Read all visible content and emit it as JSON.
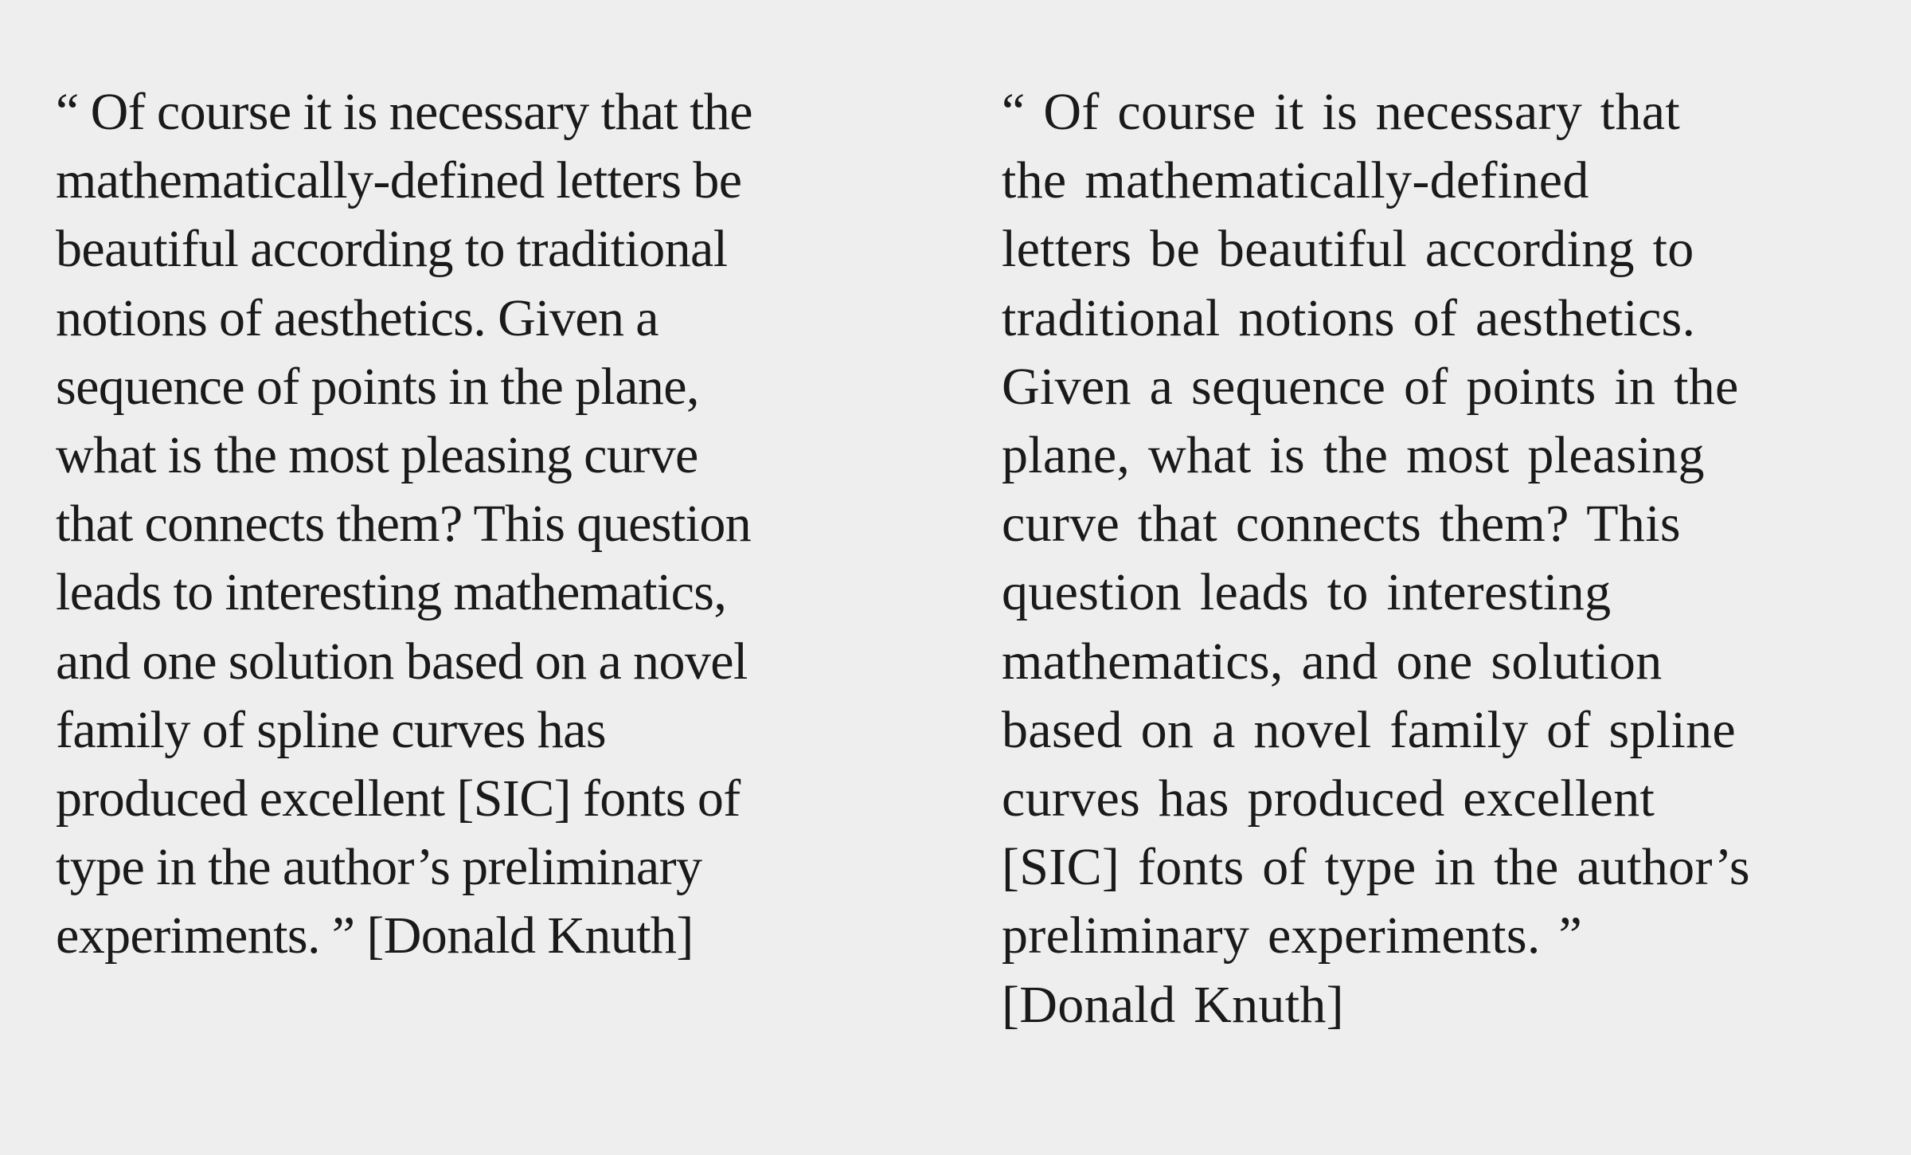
{
  "left_column": {
    "lines": [
      "“ Of course it is necessary that the",
      "mathematically-defined letters be",
      "beautiful according to traditional",
      "notions of aesthetics. Given a",
      "sequence of points in the plane,",
      "what is the most pleasing curve",
      "that connects them? This question",
      "leads to interesting mathematics,",
      "and one solution based on a novel",
      "family of spline curves has",
      "produced excellent [SIC] fonts of",
      "type in the author’s preliminary",
      "experiments. ” [Donald Knuth]"
    ]
  },
  "right_column": {
    "lines": [
      "“ Of course it is necessary that",
      "the mathematically-defined",
      "letters be beautiful according to",
      "traditional notions of aesthetics.",
      "Given a sequence of points in the",
      "plane, what is the most pleasing",
      "curve that connects them? This",
      "question leads to interesting",
      "mathematics, and one solution",
      "based on a novel family of spline",
      "curves has produced excellent",
      "[SIC] fonts of type in the author’s",
      "preliminary experiments. ”",
      "[Donald Knuth]"
    ]
  }
}
